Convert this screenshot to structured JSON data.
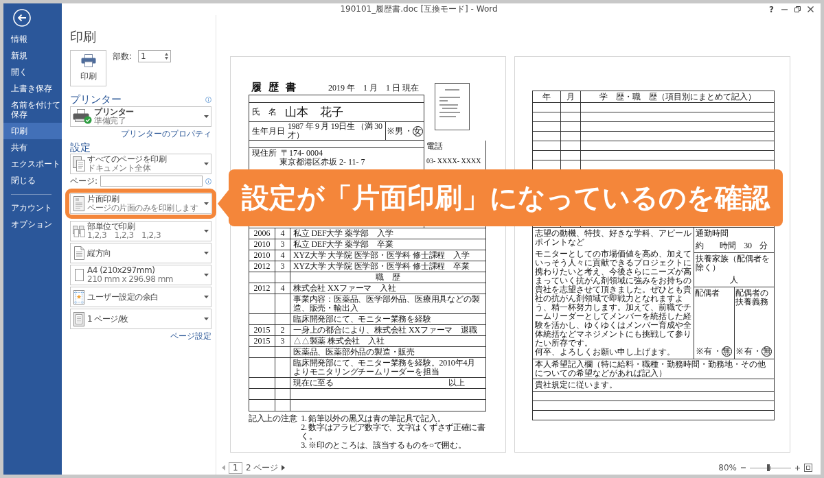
{
  "window": {
    "title": "190101_履歴書.doc [互換モード] - Word",
    "help": "?"
  },
  "sidebar": {
    "items": [
      {
        "label": "情報",
        "selected": false
      },
      {
        "label": "新規",
        "selected": false
      },
      {
        "label": "開く",
        "selected": false
      },
      {
        "label": "上書き保存",
        "selected": false
      },
      {
        "label": "名前を付けて保存",
        "selected": false
      },
      {
        "label": "印刷",
        "selected": true
      },
      {
        "label": "共有",
        "selected": false
      },
      {
        "label": "エクスポート",
        "selected": false
      },
      {
        "label": "閉じる",
        "selected": false
      }
    ],
    "bottom_items": [
      {
        "label": "アカウント",
        "selected": false
      },
      {
        "label": "オプション",
        "selected": false
      }
    ]
  },
  "print_panel": {
    "title": "印刷",
    "print_button": "印刷",
    "copies": {
      "label": "部数:",
      "value": "1"
    },
    "printer": {
      "heading": "プリンター",
      "name": "プリンター",
      "status": "準備完了",
      "properties_link": "プリンターのプロパティ"
    },
    "settings": {
      "heading": "設定",
      "options": [
        {
          "kind": "pages",
          "title": "すべてのページを印刷",
          "subtitle": "ドキュメント全体",
          "highlighted": false
        },
        {
          "kind": "field",
          "label": "ページ:",
          "highlighted": false
        },
        {
          "kind": "sides",
          "title": "片面印刷",
          "subtitle": "ページの片面のみを印刷します",
          "highlighted": true
        },
        {
          "kind": "collate",
          "title": "部単位で印刷",
          "subtitle": "1,2,3　1,2,3　1,2,3",
          "highlighted": false
        },
        {
          "kind": "orientation",
          "title": "縦方向",
          "highlighted": false
        },
        {
          "kind": "paper",
          "title": "A4 (210x297mm)",
          "subtitle": "210 mm x 296.98 mm",
          "highlighted": false
        },
        {
          "kind": "margins",
          "title": "ユーザー設定の余白",
          "highlighted": false
        },
        {
          "kind": "persheet",
          "title": "1 ページ/枚",
          "highlighted": false
        }
      ],
      "page_setup_link": "ページ設定"
    }
  },
  "callout": {
    "text": "設定が「片面印刷」になっているのを確認"
  },
  "preview": {
    "page_1": {
      "title": "履 歴 書",
      "date": "2019 年　1 月　1 日 現在",
      "name_label": "氏　名",
      "name": "山本　花子",
      "birth_label": "生年月日",
      "birth": "1987 年 9 月 19日生 （満 30 才）",
      "gender": {
        "prefix": "※",
        "separator": "・",
        "options": [
          {
            "text": "男",
            "selected": false
          },
          {
            "text": "女",
            "selected": true
          }
        ]
      },
      "phone_label": "電話",
      "address_label": "現住所",
      "postal": "〒174- 0004",
      "address": "東京都港区赤坂 2- 11- 7",
      "phone": "03- XXXX- XXXX",
      "history": [
        {
          "kind": "entry",
          "year": "2006",
          "month": "4",
          "text": "私立 DEF大学 薬学部　入学"
        },
        {
          "kind": "entry",
          "year": "2010",
          "month": "3",
          "text": "私立 DEF大学 薬学部　卒業"
        },
        {
          "kind": "entry",
          "year": "2010",
          "month": "4",
          "text": "XYZ大学 大学院 医学部・医学科 修士課程　入学"
        },
        {
          "kind": "entry",
          "year": "2012",
          "month": "3",
          "text": "XYZ大学 大学院 医学部・医学科 修士課程　卒業"
        },
        {
          "kind": "heading",
          "text": "職　歴"
        },
        {
          "kind": "entry",
          "year": "2012",
          "month": "4",
          "text": "株式会社 XXファーマ　入社"
        },
        {
          "kind": "entry",
          "text": "事業内容：医薬品、医学部外品、医療用具などの製造、販売・輸出入"
        },
        {
          "kind": "entry",
          "text": "臨床開発部にて、モニター業務を経験"
        },
        {
          "kind": "entry",
          "year": "2015",
          "month": "2",
          "text": "一身上の都合により、株式会社 XXファーマ　退職"
        },
        {
          "kind": "entry",
          "year": "2015",
          "month": "3",
          "text": "△△製薬 株式会社　入社"
        },
        {
          "kind": "entry",
          "text": "医薬品、医薬部外品の製造・販売"
        },
        {
          "kind": "entry",
          "text": "臨床開発部にて、モニター業務を経験。2010年4月よりモニタリングチームリーダーを担当"
        },
        {
          "kind": "closing",
          "text": "現在に至る",
          "end": "以上"
        },
        {
          "kind": "blank"
        },
        {
          "kind": "blank"
        }
      ],
      "notes": {
        "label": "記入上の注意",
        "items": [
          "1. 鉛筆以外の黒又は青の筆記具で記入。",
          "2. 数字はアラビア数字で、文字はくずさず正確に書く。",
          "3. ※印のところは、該当するものを○で囲む。"
        ]
      }
    },
    "page_2": {
      "header": {
        "year": "年",
        "month": "月",
        "title": "学　歴・職　歴（項目別にまとめて記入）"
      },
      "rows": [
        {
          "kind": "blank"
        },
        {
          "kind": "blank"
        },
        {
          "kind": "blank"
        },
        {
          "kind": "blank"
        },
        {
          "kind": "blank"
        },
        {
          "kind": "blank"
        },
        {
          "kind": "blank"
        },
        {
          "kind": "blank"
        },
        {
          "kind": "blank"
        },
        {
          "kind": "blank"
        },
        {
          "kind": "blank"
        },
        {
          "kind": "blank"
        },
        {
          "kind": "blank"
        }
      ],
      "motivation": {
        "heading": "志望の動機、特技、好きな学科、アピールポイントなど",
        "text": "モニターとしての市場価値を高め、加えていっそう人々に貢献できるプロジェクトに携わりたいと考え、今後さらにニーズが高まっていく抗がん剤領域に強みをお持ちの貴社を志望させて頂きました。ぜひとも貴社の抗がん剤領域で即戦力となれますよう、精一杯努力します。加えて、前職でチームリーダーとしてメンバーを統括した経験を活かし、ゆくゆくはメンバー育成や全体統括などマネジメントにも挑戦して参りたい所存です。",
        "closing": "何卒、よろしくお願い申し上げます。"
      },
      "commute": {
        "label": "通勤時間",
        "value": "約　　時間　30　分"
      },
      "dependents": {
        "label": "扶養家族（配偶者を除く）",
        "value": "人"
      },
      "spouse": {
        "label": "配偶者",
        "prefix": "※",
        "separator": "・",
        "options": [
          {
            "text": "有",
            "selected": false
          },
          {
            "text": "無",
            "selected": true
          }
        ]
      },
      "spouse_support": {
        "label": "配偶者の扶養義務",
        "prefix": "※",
        "separator": "・",
        "options": [
          {
            "text": "有",
            "selected": false
          },
          {
            "text": "無",
            "selected": true
          }
        ]
      },
      "requests": {
        "heading": "本人希望記入欄（特に給料・職種・勤務時間・勤務地・その他についての希望などがあれば記入）",
        "text": "貴社規定に従います。"
      },
      "request_rows": [
        {
          "kind": "blank"
        },
        {
          "kind": "blank"
        },
        {
          "kind": "blank"
        }
      ]
    }
  },
  "status_bar": {
    "page_field": "1",
    "page_count": "2 ページ",
    "zoom": "80%",
    "zoom_slider": {
      "level": 0.45
    }
  }
}
